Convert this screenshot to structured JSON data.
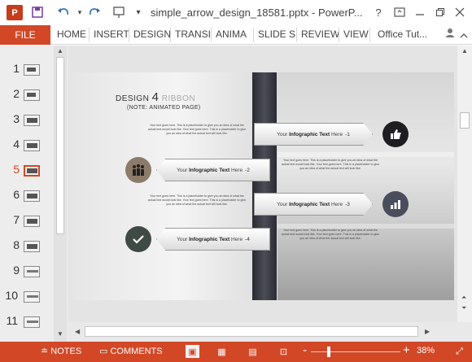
{
  "app": {
    "logo_text": "P",
    "doc_title": "simple_arrow_design_18581.pptx - PowerP..."
  },
  "quick_access": {
    "save_icon": "save-icon",
    "undo_icon": "undo-icon",
    "redo_icon": "redo-icon",
    "present_icon": "start-from-beginning-icon",
    "customize_icon": "customize-quick-access-icon"
  },
  "window": {
    "help": "?",
    "ribbon_display": "ribbon-display-options-icon",
    "minimize": "minimize-icon",
    "restore": "restore-icon",
    "close": "close-icon"
  },
  "ribbon": {
    "file": "FILE",
    "tabs": [
      "HOME",
      "INSERT",
      "DESIGN",
      "TRANSI",
      "ANIMA",
      "SLIDE S",
      "REVIEW",
      "VIEW"
    ],
    "account": "Office Tut..."
  },
  "thumbnails": {
    "numbers": [
      "1",
      "2",
      "3",
      "4",
      "5",
      "6",
      "7",
      "8",
      "9",
      "10",
      "11"
    ],
    "active_index": 5
  },
  "slide": {
    "title_word": "DESIGN",
    "title_num": "4",
    "title_ribbon": "RIBBON",
    "subtitle": "(NOTE: ANIMATED PAGE)",
    "placeholder_text": "Your text goes here. This is a placeholder to give you an idea of what the actual text would look like. Your text goes here. This is a placeholder to give you an idea of what the actual text will look like.",
    "ribbons": [
      {
        "prefix": "Your",
        "bold": "Infographic Text",
        "suffix": "Here",
        "num": "-1"
      },
      {
        "prefix": "Your",
        "bold": "Infographic Text",
        "suffix": "Here",
        "num": "-2"
      },
      {
        "prefix": "Your",
        "bold": "Infographic Text",
        "suffix": "Here",
        "num": "-3"
      },
      {
        "prefix": "Your",
        "bold": "Infographic Text",
        "suffix": "Here",
        "num": "-4"
      }
    ]
  },
  "statusbar": {
    "notes": "NOTES",
    "comments": "COMMENTS",
    "zoom_minus": "-",
    "zoom_plus": "+",
    "zoom": "38%"
  },
  "colors": {
    "accent": "#d24726",
    "circle_dark": "#1e1e22",
    "circle_beige": "#8c7b6a",
    "circle_slate": "#4a4d5c",
    "circle_green": "#3f4a45"
  }
}
